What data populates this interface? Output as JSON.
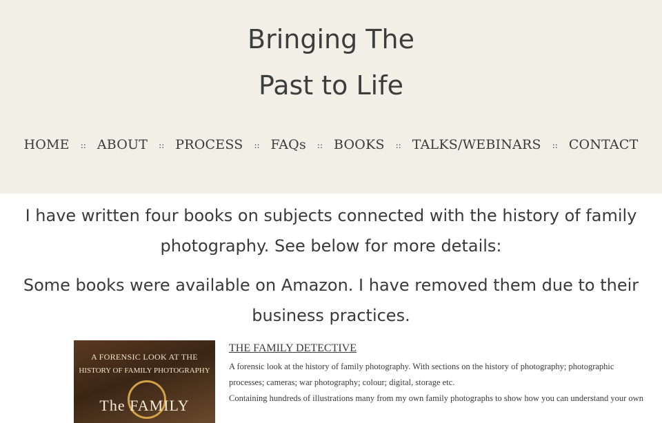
{
  "site": {
    "title_line1": "Bringing The",
    "title_line2": "Past to Life"
  },
  "nav": {
    "items": [
      {
        "label": "HOME"
      },
      {
        "label": "ABOUT"
      },
      {
        "label": "PROCESS"
      },
      {
        "label": "FAQs"
      },
      {
        "label": "BOOKS"
      },
      {
        "label": "TALKS/WEBINARS"
      },
      {
        "label": "CONTACT"
      }
    ],
    "separator": "::"
  },
  "main": {
    "intro": "I have written four books on subjects connected with the history of family photography. See below for more details:",
    "notice": "Some books were available on Amazon. I have removed them due to their business practices.",
    "books": [
      {
        "cover_line1": "A FORENSIC LOOK AT THE",
        "cover_line2": "HISTORY OF FAMILY PHOTOGRAPHY",
        "cover_title": "The FAMILY",
        "title": "THE FAMILY DETECTIVE",
        "description_1": "A forensic look at the history of family photography. With sections on the history of photography; photographic processes; cameras; war photography; colour; digital, storage etc.",
        "description_2": "Containing hundreds of illustrations many from my own family photographs to show how you can understand your own"
      }
    ]
  },
  "colors": {
    "header_bg": "#f2efe7",
    "text": "#3a3a3a",
    "page_bg": "#ffffff"
  }
}
